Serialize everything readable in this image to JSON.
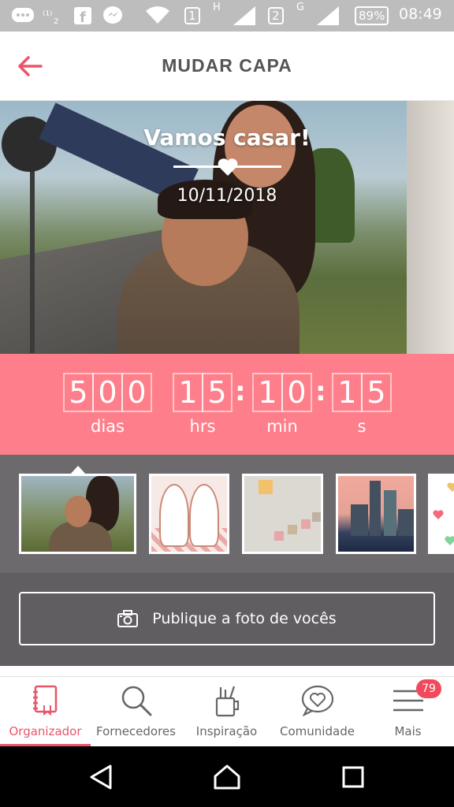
{
  "status_bar": {
    "sim1_label": "1",
    "sim1_net": "H",
    "sim2_label": "2",
    "sim2_net": "G",
    "battery": "89%",
    "time": "08:49"
  },
  "header": {
    "title": "MUDAR CAPA",
    "back_icon": "arrow-left-icon"
  },
  "cover": {
    "title": "Vamos casar!",
    "date": "10/11/2018"
  },
  "countdown": {
    "days_digits": [
      "5",
      "0",
      "0"
    ],
    "hours_digits": [
      "1",
      "5"
    ],
    "minutes_digits": [
      "1",
      "0"
    ],
    "seconds_digits": [
      "1",
      "5"
    ],
    "days_label": "dias",
    "hours_label": "hrs",
    "minutes_label": "min",
    "seconds_label": "s",
    "separator": ":"
  },
  "thumbnails": {
    "selected_index": 0,
    "items": [
      "couple-photo",
      "bunnies-illustration",
      "bunting-flags",
      "city-skyline",
      "hearts-pattern"
    ]
  },
  "publish": {
    "label": "Publique a foto de vocês",
    "icon": "camera-icon"
  },
  "bottom_nav": {
    "items": [
      {
        "label": "Organizador",
        "icon": "notebook-icon",
        "active": true
      },
      {
        "label": "Fornecedores",
        "icon": "search-icon",
        "active": false
      },
      {
        "label": "Inspiração",
        "icon": "pencil-cup-icon",
        "active": false
      },
      {
        "label": "Comunidade",
        "icon": "heart-chat-icon",
        "active": false
      },
      {
        "label": "Mais",
        "icon": "menu-icon",
        "active": false
      }
    ],
    "badge": "79"
  },
  "colors": {
    "accent": "#e8566a",
    "countdown_bg": "#fe7f8b",
    "strip_bg": "#6c6a6c",
    "publish_bg": "#605e60"
  }
}
